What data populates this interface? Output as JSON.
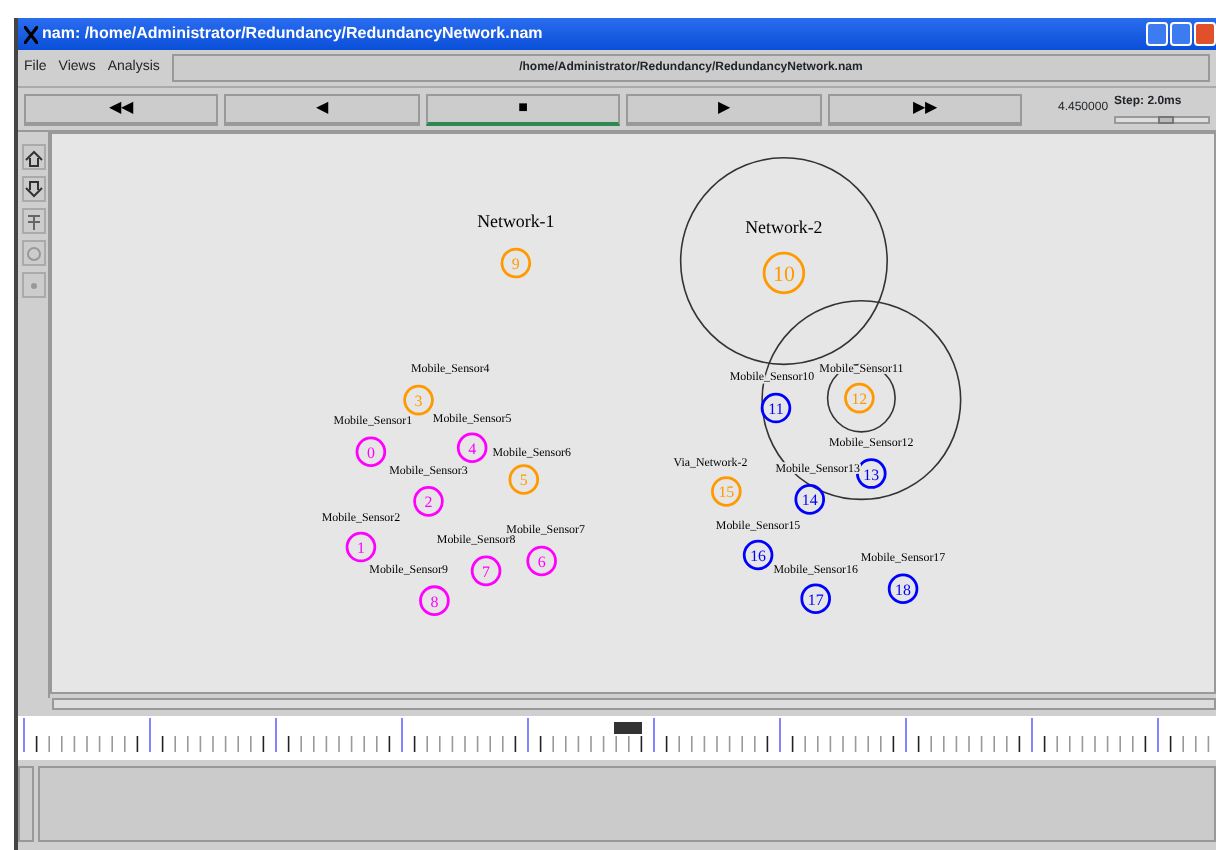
{
  "window": {
    "title": "nam: /home/Administrator/Redundancy/RedundancyNetwork.nam"
  },
  "menu": [
    "File",
    "Views",
    "Analysis"
  ],
  "file_path": "/home/Administrator/Redundancy/RedundancyNetwork.nam",
  "transport": [
    {
      "symbol": "◀◀",
      "selected": false
    },
    {
      "symbol": "◀",
      "selected": false
    },
    {
      "symbol": "■",
      "selected": true
    },
    {
      "symbol": "▶",
      "selected": false
    },
    {
      "symbol": "▶▶",
      "selected": false
    }
  ],
  "time": "4.450000",
  "step": {
    "label": "Step: 2.0ms",
    "level": 0.55
  },
  "networks": [
    "Network-1",
    "Network-2"
  ],
  "nodes": [
    {
      "number": "9",
      "color": "#ff9900"
    },
    {
      "number": "10",
      "color": "#ff9900"
    },
    {
      "label": "Mobile_Sensor4",
      "number": "3",
      "color": "#ff9900"
    },
    {
      "label": "Mobile_Sensor1",
      "number": "0",
      "color": "#ff00ff"
    },
    {
      "label": "Mobile_Sensor5",
      "number": "4",
      "color": "#ff00ff"
    },
    {
      "label": "Mobile_Sensor6",
      "number": "5",
      "color": "#ff9900"
    },
    {
      "label": "Mobile_Sensor3",
      "number": "2",
      "color": "#ff00ff"
    },
    {
      "label": "Mobile_Sensor2",
      "number": "1",
      "color": "#ff00ff"
    },
    {
      "label": "Mobile_Sensor8",
      "number": "7",
      "color": "#ff00ff"
    },
    {
      "label": "Mobile_Sensor7",
      "number": "6",
      "color": "#ff00ff"
    },
    {
      "label": "Mobile_Sensor9",
      "number": "8",
      "color": "#ff00ff"
    },
    {
      "label": "Mobile_Sensor10",
      "number": "11",
      "color": "#0000ff"
    },
    {
      "label": "Mobile_Sensor11",
      "number": "12",
      "color": "#ff9900"
    },
    {
      "label": "Mobile_Sensor12",
      "number": "13",
      "color": "#0000ff"
    },
    {
      "label": "Mobile_Sensor13",
      "number": "14",
      "color": "#0000ff"
    },
    {
      "label": "Via_Network-2",
      "number": "15",
      "color": "#ff9900"
    },
    {
      "label": "Mobile_Sensor15",
      "number": "16",
      "color": "#0000ff"
    },
    {
      "label": "Mobile_Sensor16",
      "number": "17",
      "color": "#0000ff"
    },
    {
      "label": "Mobile_Sensor17",
      "number": "18",
      "color": "#0000ff"
    }
  ]
}
